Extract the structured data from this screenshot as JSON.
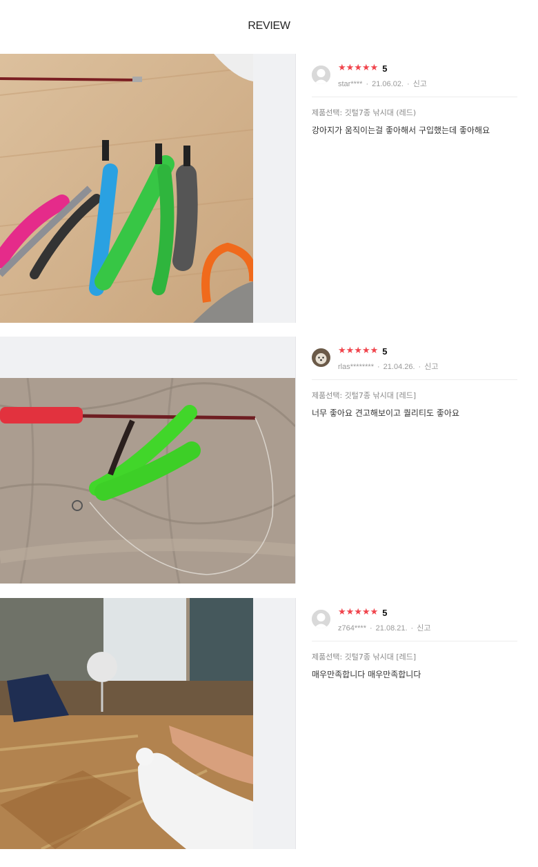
{
  "page": {
    "title": "REVIEW"
  },
  "reviews": [
    {
      "score": "5",
      "user": "star****",
      "date": "21.06.02.",
      "report_label": "신고",
      "option": "제품선택: 깃털7종 낚시대 (레드)",
      "text": "강아지가 움직이는걸 좋아해서 구입했는데 좋아해요",
      "photo_alt": "Feather cat toy attachments on a wooden floor",
      "avatar": "default-avatar-icon"
    },
    {
      "score": "5",
      "user": "rlas********",
      "date": "21.04.26.",
      "report_label": "신고",
      "option": "제품선택: 깃털7종 낚시대 [레드]",
      "text": "너무 좋아요 견고해보이고 퀄리티도 좋아요",
      "photo_alt": "Cat teaser wand with green feathers on a beige blanket",
      "avatar": "dog-photo-avatar"
    },
    {
      "score": "5",
      "user": "z764****",
      "date": "21.08.21.",
      "report_label": "신고",
      "option": "제품선택: 깃털7종 낚시대 [레드]",
      "text": "매우만족합니다 매우만족합니다",
      "photo_alt": "White cat playing with the teaser wand on the living room floor",
      "avatar": "default-avatar-icon"
    }
  ],
  "colors": {
    "star": "#f0444c",
    "panel_bg": "#f0f1f3",
    "divider": "#ececec"
  }
}
